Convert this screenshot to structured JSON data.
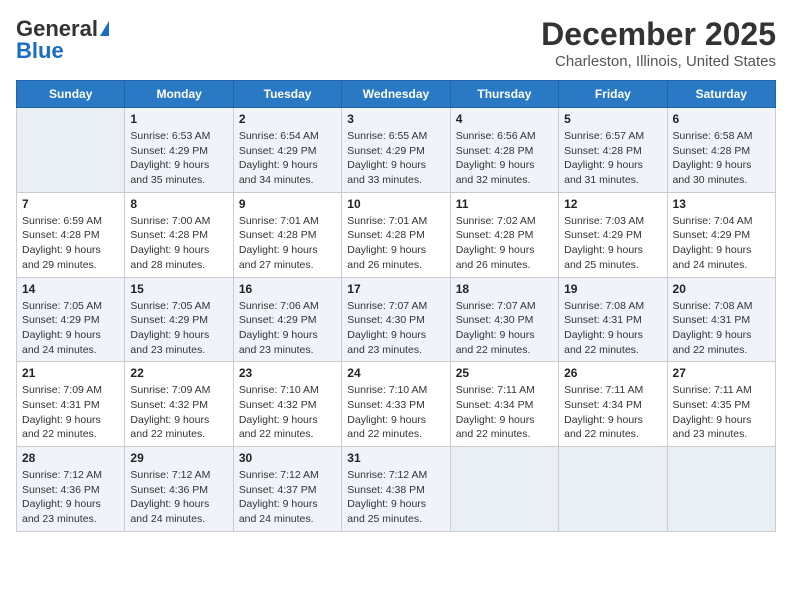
{
  "header": {
    "logo_general": "General",
    "logo_blue": "Blue",
    "month": "December 2025",
    "location": "Charleston, Illinois, United States"
  },
  "days_of_week": [
    "Sunday",
    "Monday",
    "Tuesday",
    "Wednesday",
    "Thursday",
    "Friday",
    "Saturday"
  ],
  "weeks": [
    [
      {
        "day": "",
        "empty": true
      },
      {
        "day": "1",
        "sunrise": "6:53 AM",
        "sunset": "4:29 PM",
        "daylight": "9 hours and 35 minutes."
      },
      {
        "day": "2",
        "sunrise": "6:54 AM",
        "sunset": "4:29 PM",
        "daylight": "9 hours and 34 minutes."
      },
      {
        "day": "3",
        "sunrise": "6:55 AM",
        "sunset": "4:29 PM",
        "daylight": "9 hours and 33 minutes."
      },
      {
        "day": "4",
        "sunrise": "6:56 AM",
        "sunset": "4:28 PM",
        "daylight": "9 hours and 32 minutes."
      },
      {
        "day": "5",
        "sunrise": "6:57 AM",
        "sunset": "4:28 PM",
        "daylight": "9 hours and 31 minutes."
      },
      {
        "day": "6",
        "sunrise": "6:58 AM",
        "sunset": "4:28 PM",
        "daylight": "9 hours and 30 minutes."
      }
    ],
    [
      {
        "day": "7",
        "sunrise": "6:59 AM",
        "sunset": "4:28 PM",
        "daylight": "9 hours and 29 minutes."
      },
      {
        "day": "8",
        "sunrise": "7:00 AM",
        "sunset": "4:28 PM",
        "daylight": "9 hours and 28 minutes."
      },
      {
        "day": "9",
        "sunrise": "7:01 AM",
        "sunset": "4:28 PM",
        "daylight": "9 hours and 27 minutes."
      },
      {
        "day": "10",
        "sunrise": "7:01 AM",
        "sunset": "4:28 PM",
        "daylight": "9 hours and 26 minutes."
      },
      {
        "day": "11",
        "sunrise": "7:02 AM",
        "sunset": "4:28 PM",
        "daylight": "9 hours and 26 minutes."
      },
      {
        "day": "12",
        "sunrise": "7:03 AM",
        "sunset": "4:29 PM",
        "daylight": "9 hours and 25 minutes."
      },
      {
        "day": "13",
        "sunrise": "7:04 AM",
        "sunset": "4:29 PM",
        "daylight": "9 hours and 24 minutes."
      }
    ],
    [
      {
        "day": "14",
        "sunrise": "7:05 AM",
        "sunset": "4:29 PM",
        "daylight": "9 hours and 24 minutes."
      },
      {
        "day": "15",
        "sunrise": "7:05 AM",
        "sunset": "4:29 PM",
        "daylight": "9 hours and 23 minutes."
      },
      {
        "day": "16",
        "sunrise": "7:06 AM",
        "sunset": "4:29 PM",
        "daylight": "9 hours and 23 minutes."
      },
      {
        "day": "17",
        "sunrise": "7:07 AM",
        "sunset": "4:30 PM",
        "daylight": "9 hours and 23 minutes."
      },
      {
        "day": "18",
        "sunrise": "7:07 AM",
        "sunset": "4:30 PM",
        "daylight": "9 hours and 22 minutes."
      },
      {
        "day": "19",
        "sunrise": "7:08 AM",
        "sunset": "4:31 PM",
        "daylight": "9 hours and 22 minutes."
      },
      {
        "day": "20",
        "sunrise": "7:08 AM",
        "sunset": "4:31 PM",
        "daylight": "9 hours and 22 minutes."
      }
    ],
    [
      {
        "day": "21",
        "sunrise": "7:09 AM",
        "sunset": "4:31 PM",
        "daylight": "9 hours and 22 minutes."
      },
      {
        "day": "22",
        "sunrise": "7:09 AM",
        "sunset": "4:32 PM",
        "daylight": "9 hours and 22 minutes."
      },
      {
        "day": "23",
        "sunrise": "7:10 AM",
        "sunset": "4:32 PM",
        "daylight": "9 hours and 22 minutes."
      },
      {
        "day": "24",
        "sunrise": "7:10 AM",
        "sunset": "4:33 PM",
        "daylight": "9 hours and 22 minutes."
      },
      {
        "day": "25",
        "sunrise": "7:11 AM",
        "sunset": "4:34 PM",
        "daylight": "9 hours and 22 minutes."
      },
      {
        "day": "26",
        "sunrise": "7:11 AM",
        "sunset": "4:34 PM",
        "daylight": "9 hours and 22 minutes."
      },
      {
        "day": "27",
        "sunrise": "7:11 AM",
        "sunset": "4:35 PM",
        "daylight": "9 hours and 23 minutes."
      }
    ],
    [
      {
        "day": "28",
        "sunrise": "7:12 AM",
        "sunset": "4:36 PM",
        "daylight": "9 hours and 23 minutes."
      },
      {
        "day": "29",
        "sunrise": "7:12 AM",
        "sunset": "4:36 PM",
        "daylight": "9 hours and 24 minutes."
      },
      {
        "day": "30",
        "sunrise": "7:12 AM",
        "sunset": "4:37 PM",
        "daylight": "9 hours and 24 minutes."
      },
      {
        "day": "31",
        "sunrise": "7:12 AM",
        "sunset": "4:38 PM",
        "daylight": "9 hours and 25 minutes."
      },
      {
        "day": "",
        "empty": true
      },
      {
        "day": "",
        "empty": true
      },
      {
        "day": "",
        "empty": true
      }
    ]
  ],
  "labels": {
    "sunrise": "Sunrise:",
    "sunset": "Sunset:",
    "daylight": "Daylight:"
  }
}
